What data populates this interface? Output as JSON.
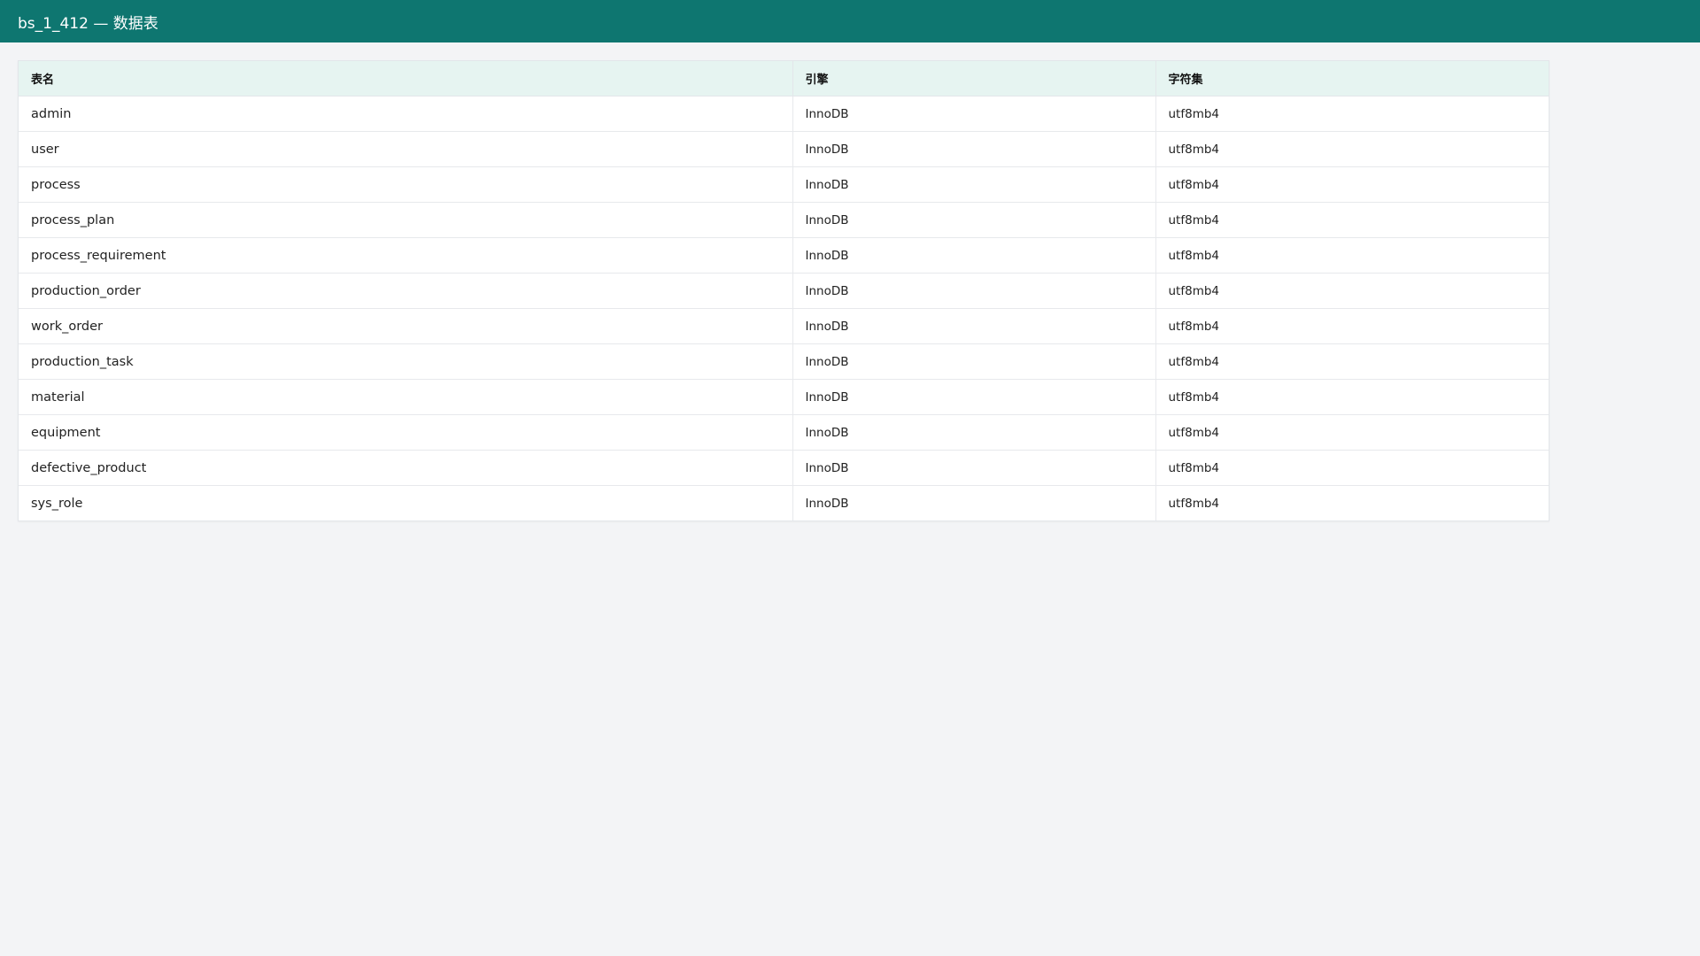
{
  "header": {
    "title": "bs_1_412 — 数据表"
  },
  "table": {
    "columns": [
      "表名",
      "引擎",
      "字符集"
    ],
    "rows": [
      {
        "name": "admin",
        "engine": "InnoDB",
        "charset": "utf8mb4"
      },
      {
        "name": "user",
        "engine": "InnoDB",
        "charset": "utf8mb4"
      },
      {
        "name": "process",
        "engine": "InnoDB",
        "charset": "utf8mb4"
      },
      {
        "name": "process_plan",
        "engine": "InnoDB",
        "charset": "utf8mb4"
      },
      {
        "name": "process_requirement",
        "engine": "InnoDB",
        "charset": "utf8mb4"
      },
      {
        "name": "production_order",
        "engine": "InnoDB",
        "charset": "utf8mb4"
      },
      {
        "name": "work_order",
        "engine": "InnoDB",
        "charset": "utf8mb4"
      },
      {
        "name": "production_task",
        "engine": "InnoDB",
        "charset": "utf8mb4"
      },
      {
        "name": "material",
        "engine": "InnoDB",
        "charset": "utf8mb4"
      },
      {
        "name": "equipment",
        "engine": "InnoDB",
        "charset": "utf8mb4"
      },
      {
        "name": "defective_product",
        "engine": "InnoDB",
        "charset": "utf8mb4"
      },
      {
        "name": "sys_role",
        "engine": "InnoDB",
        "charset": "utf8mb4"
      }
    ]
  },
  "colors": {
    "header_bg": "#0e7670",
    "table_head_bg": "#e6f4f1",
    "page_bg": "#f3f4f6"
  }
}
